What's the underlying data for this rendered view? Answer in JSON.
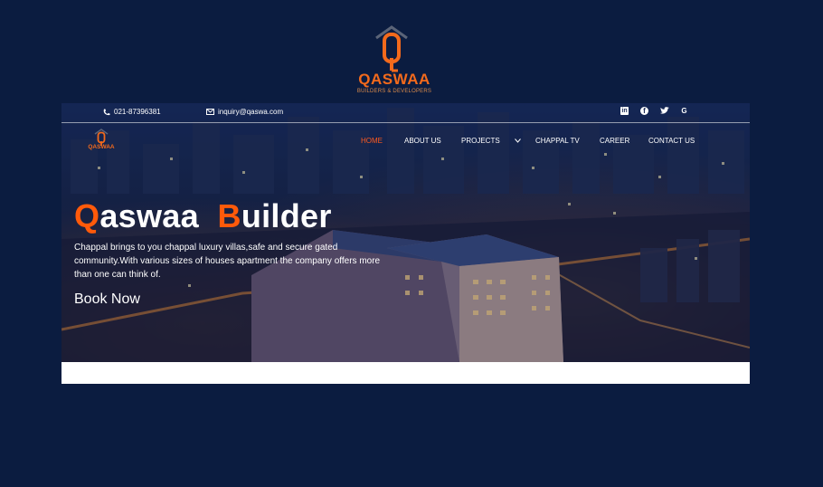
{
  "logo": {
    "brand": "QASWAA",
    "tagline": "BUILDERS & DEVELOPERS",
    "icon": "house-q-logo-icon"
  },
  "topbar": {
    "phone": "021-87396381",
    "email": "inquiry@qaswa.com",
    "phone_icon": "phone-icon",
    "email_icon": "mail-icon",
    "social": [
      "linkedin-icon",
      "facebook-icon",
      "twitter-icon",
      "google-icon"
    ]
  },
  "nav": {
    "items": [
      "HOME",
      "ABOUT US",
      "PROJECTS",
      "CHAPPAL TV",
      "CAREER",
      "CONTACT US"
    ],
    "active": "HOME"
  },
  "hero": {
    "headline_first_letter_1": "Q",
    "headline_rest_1": "aswaa",
    "headline_first_letter_2": "B",
    "headline_rest_2": "uilder",
    "description": "Chappal brings to you chappal luxury villas,safe and secure gated community.With various sizes of houses apartment the company offers more than one can think of.",
    "cta": "Book Now"
  },
  "colors": {
    "page_bg": "#0b1c40",
    "accent": "#ff5a0a",
    "nav_active": "#ff5a1f"
  }
}
